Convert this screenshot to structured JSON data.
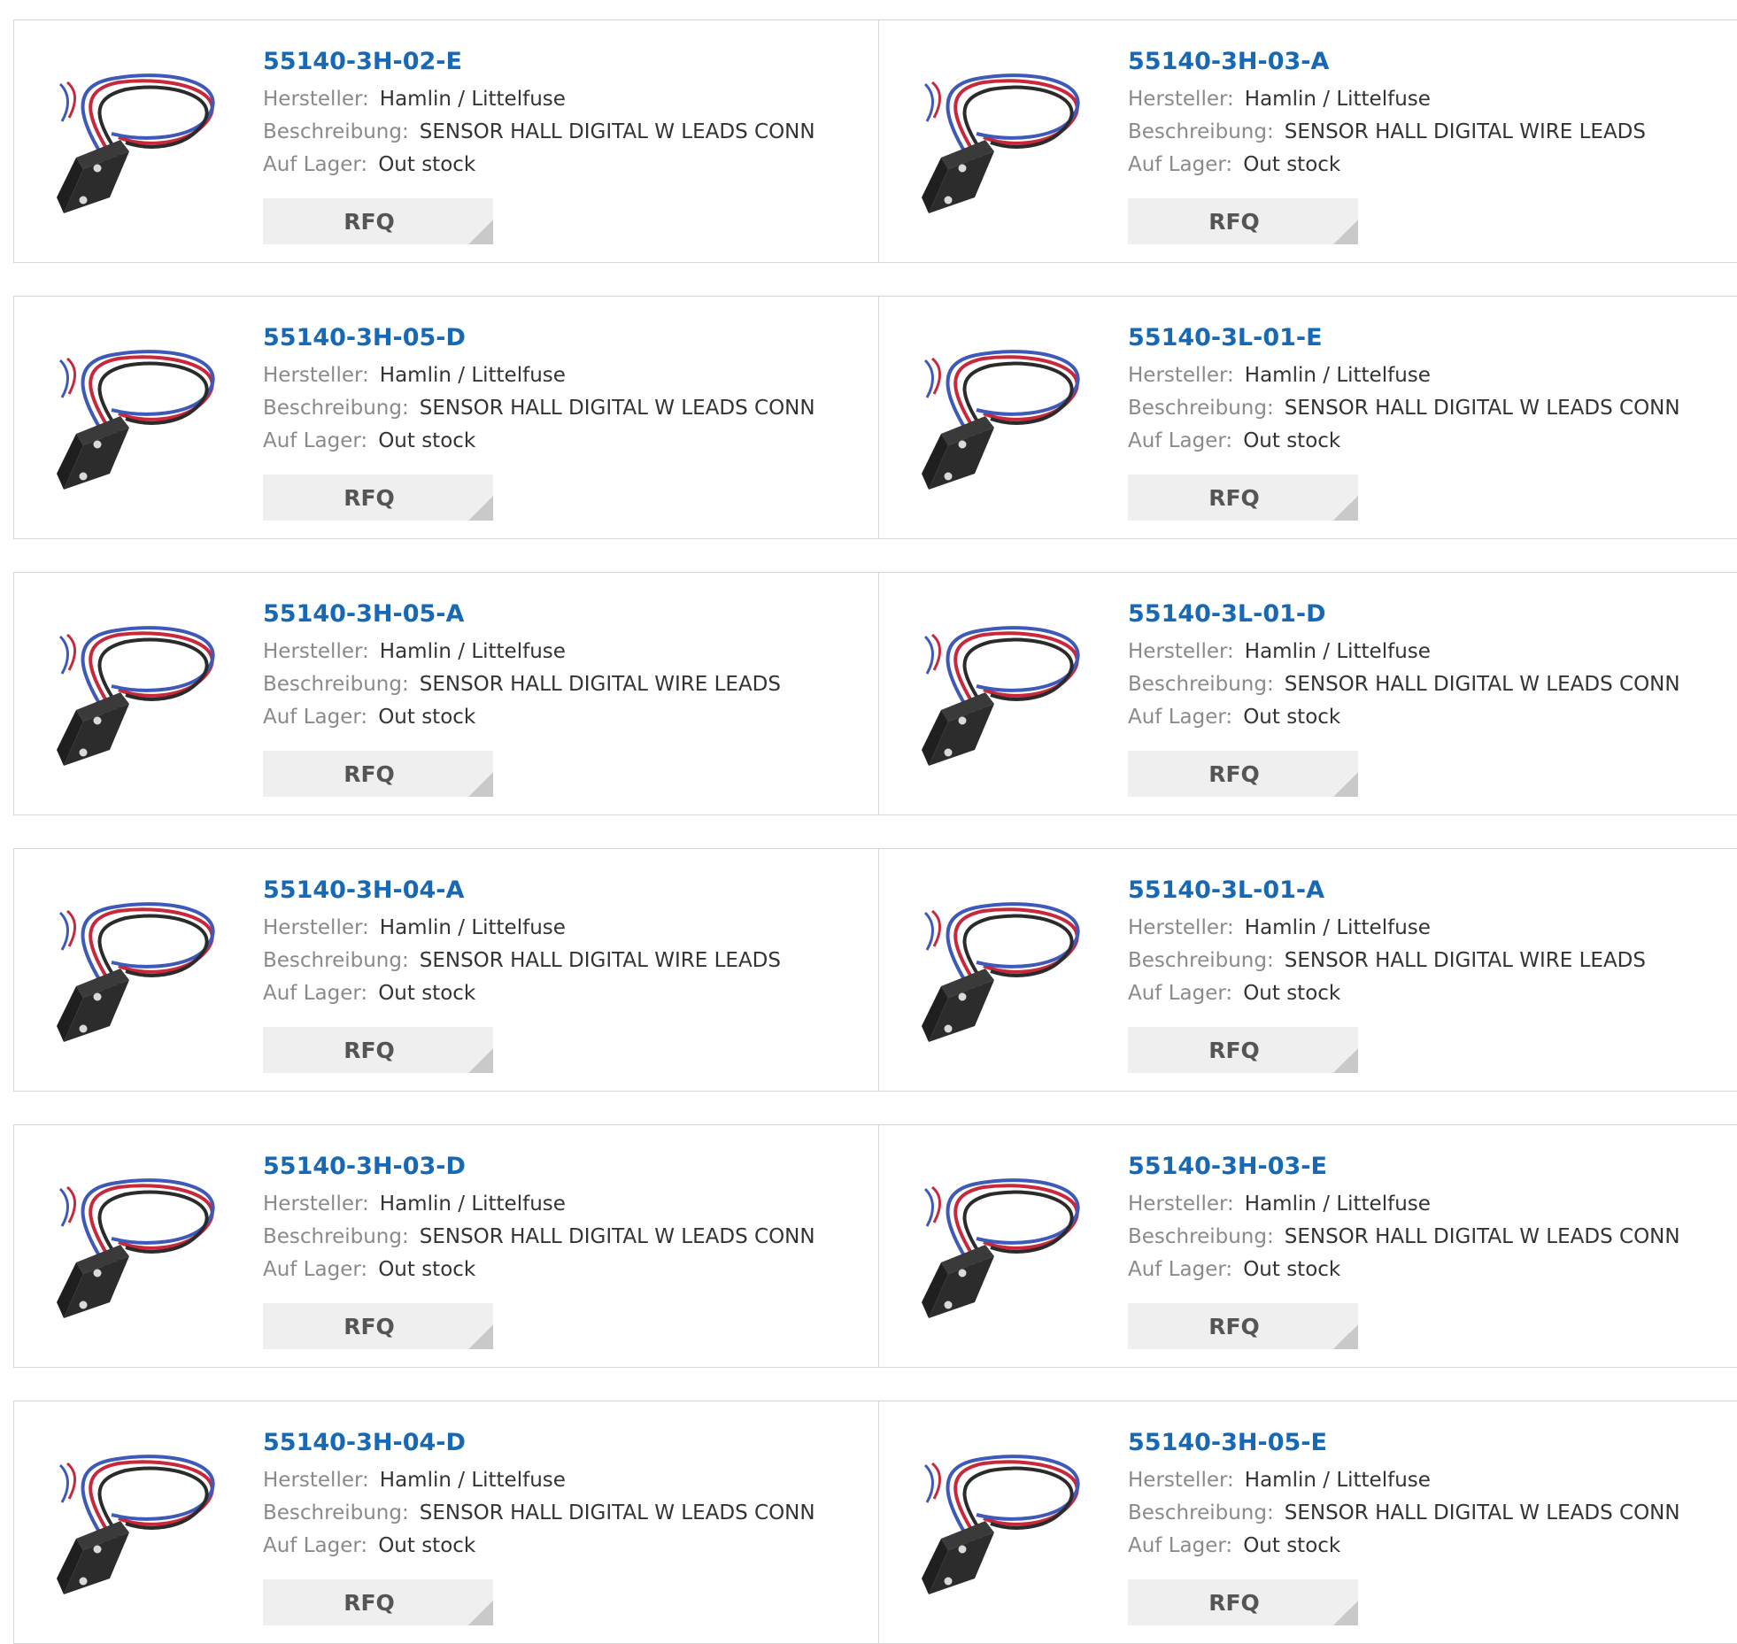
{
  "labels": {
    "manufacturer": "Hersteller:",
    "description": "Beschreibung:",
    "stock": "Auf Lager:"
  },
  "products": [
    {
      "part": "55140-3H-02-E",
      "manufacturer": "Hamlin / Littelfuse",
      "description": "SENSOR HALL DIGITAL W LEADS CONN",
      "stock": "Out stock",
      "button": "RFQ",
      "image": "hall-sensor-with-leads-image"
    },
    {
      "part": "55140-3H-03-A",
      "manufacturer": "Hamlin / Littelfuse",
      "description": "SENSOR HALL DIGITAL WIRE LEADS",
      "stock": "Out stock",
      "button": "RFQ",
      "image": "hall-sensor-wire-leads-image"
    },
    {
      "part": "55140-3H-05-D",
      "manufacturer": "Hamlin / Littelfuse",
      "description": "SENSOR HALL DIGITAL W LEADS CONN",
      "stock": "Out stock",
      "button": "RFQ",
      "image": "hall-sensor-with-leads-image"
    },
    {
      "part": "55140-3L-01-E",
      "manufacturer": "Hamlin / Littelfuse",
      "description": "SENSOR HALL DIGITAL W LEADS CONN",
      "stock": "Out stock",
      "button": "RFQ",
      "image": "hall-sensor-with-leads-image"
    },
    {
      "part": "55140-3H-05-A",
      "manufacturer": "Hamlin / Littelfuse",
      "description": "SENSOR HALL DIGITAL WIRE LEADS",
      "stock": "Out stock",
      "button": "RFQ",
      "image": "hall-sensor-wire-leads-image"
    },
    {
      "part": "55140-3L-01-D",
      "manufacturer": "Hamlin / Littelfuse",
      "description": "SENSOR HALL DIGITAL W LEADS CONN",
      "stock": "Out stock",
      "button": "RFQ",
      "image": "hall-sensor-with-leads-image"
    },
    {
      "part": "55140-3H-04-A",
      "manufacturer": "Hamlin / Littelfuse",
      "description": "SENSOR HALL DIGITAL WIRE LEADS",
      "stock": "Out stock",
      "button": "RFQ",
      "image": "hall-sensor-wire-leads-image"
    },
    {
      "part": "55140-3L-01-A",
      "manufacturer": "Hamlin / Littelfuse",
      "description": "SENSOR HALL DIGITAL WIRE LEADS",
      "stock": "Out stock",
      "button": "RFQ",
      "image": "hall-sensor-wire-leads-image"
    },
    {
      "part": "55140-3H-03-D",
      "manufacturer": "Hamlin / Littelfuse",
      "description": "SENSOR HALL DIGITAL W LEADS CONN",
      "stock": "Out stock",
      "button": "RFQ",
      "image": "hall-sensor-with-leads-image"
    },
    {
      "part": "55140-3H-03-E",
      "manufacturer": "Hamlin / Littelfuse",
      "description": "SENSOR HALL DIGITAL W LEADS CONN",
      "stock": "Out stock",
      "button": "RFQ",
      "image": "hall-sensor-with-leads-image"
    },
    {
      "part": "55140-3H-04-D",
      "manufacturer": "Hamlin / Littelfuse",
      "description": "SENSOR HALL DIGITAL W LEADS CONN",
      "stock": "Out stock",
      "button": "RFQ",
      "image": "hall-sensor-with-leads-image"
    },
    {
      "part": "55140-3H-05-E",
      "manufacturer": "Hamlin / Littelfuse",
      "description": "SENSOR HALL DIGITAL W LEADS CONN",
      "stock": "Out stock",
      "button": "RFQ",
      "image": "hall-sensor-with-leads-image"
    }
  ],
  "colors": {
    "link": "#1769b5",
    "label": "#8a8a8a",
    "value": "#333333",
    "button_bg": "#efefef",
    "button_text": "#555555",
    "border": "#d6d6d6",
    "wire_red": "#c8283c",
    "wire_blue": "#3f59b8",
    "wire_black": "#2b2b2b",
    "sensor_body": "#2c2c2c"
  }
}
